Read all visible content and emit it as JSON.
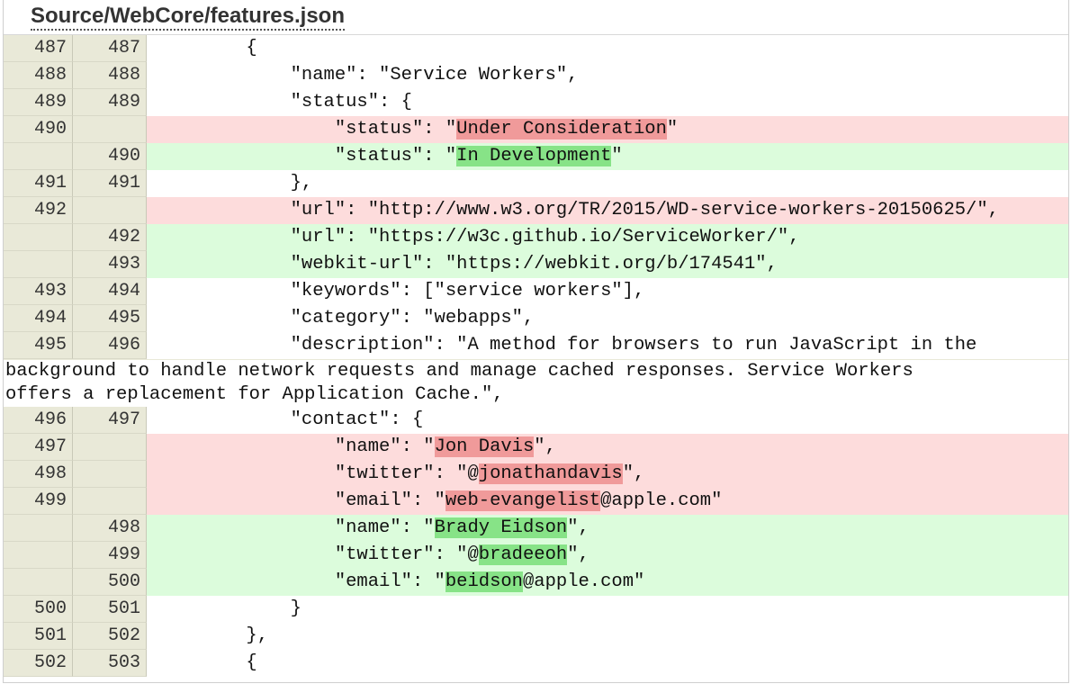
{
  "file_header": {
    "path": "Source/WebCore/features.json"
  },
  "lines": [
    {
      "old": "487",
      "new": "487",
      "type": "ctx",
      "segments": [
        {
          "t": "        {"
        }
      ]
    },
    {
      "old": "488",
      "new": "488",
      "type": "ctx",
      "segments": [
        {
          "t": "            \"name\": \"Service Workers\","
        }
      ]
    },
    {
      "old": "489",
      "new": "489",
      "type": "ctx",
      "segments": [
        {
          "t": "            \"status\": {"
        }
      ]
    },
    {
      "old": "490",
      "new": "",
      "type": "del",
      "segments": [
        {
          "t": "                \"status\": \""
        },
        {
          "t": "Under Consideration",
          "hl": true
        },
        {
          "t": "\""
        }
      ]
    },
    {
      "old": "",
      "new": "490",
      "type": "add",
      "segments": [
        {
          "t": "                \"status\": \""
        },
        {
          "t": "In Development",
          "hl": true
        },
        {
          "t": "\""
        }
      ]
    },
    {
      "old": "491",
      "new": "491",
      "type": "ctx",
      "segments": [
        {
          "t": "            },"
        }
      ]
    },
    {
      "old": "492",
      "new": "",
      "type": "del",
      "segments": [
        {
          "t": "            \"url\": \"http://www.w3.org/TR/2015/WD-service-workers-20150625/\","
        }
      ]
    },
    {
      "old": "",
      "new": "492",
      "type": "add",
      "segments": [
        {
          "t": "            \"url\": \"https://w3c.github.io/ServiceWorker/\","
        }
      ]
    },
    {
      "old": "",
      "new": "493",
      "type": "add",
      "segments": [
        {
          "t": "            \"webkit-url\": \"https://webkit.org/b/174541\","
        }
      ]
    },
    {
      "old": "493",
      "new": "494",
      "type": "ctx",
      "segments": [
        {
          "t": "            \"keywords\": [\"service workers\"],"
        }
      ]
    },
    {
      "old": "494",
      "new": "495",
      "type": "ctx",
      "segments": [
        {
          "t": "            \"category\": \"webapps\","
        }
      ]
    },
    {
      "old": "495",
      "new": "496",
      "type": "ctx",
      "segments": [
        {
          "t": "            \"description\": \"A method for browsers to run JavaScript in the"
        }
      ],
      "wrap": [
        "background to handle network requests and manage cached responses. Service Workers",
        "offers a replacement for Application Cache.\","
      ]
    },
    {
      "old": "496",
      "new": "497",
      "type": "ctx",
      "segments": [
        {
          "t": "            \"contact\": {"
        }
      ]
    },
    {
      "old": "497",
      "new": "",
      "type": "del",
      "segments": [
        {
          "t": "                \"name\": \""
        },
        {
          "t": "Jon Davis",
          "hl": true
        },
        {
          "t": "\","
        }
      ]
    },
    {
      "old": "498",
      "new": "",
      "type": "del",
      "segments": [
        {
          "t": "                \"twitter\": \"@"
        },
        {
          "t": "jonathandavis",
          "hl": true
        },
        {
          "t": "\","
        }
      ]
    },
    {
      "old": "499",
      "new": "",
      "type": "del",
      "segments": [
        {
          "t": "                \"email\": \""
        },
        {
          "t": "web-evangelist",
          "hl": true
        },
        {
          "t": "@apple.com\""
        }
      ]
    },
    {
      "old": "",
      "new": "498",
      "type": "add",
      "segments": [
        {
          "t": "                \"name\": \""
        },
        {
          "t": "Brady Eidson",
          "hl": true
        },
        {
          "t": "\","
        }
      ]
    },
    {
      "old": "",
      "new": "499",
      "type": "add",
      "segments": [
        {
          "t": "                \"twitter\": \"@"
        },
        {
          "t": "bradeeoh",
          "hl": true
        },
        {
          "t": "\","
        }
      ]
    },
    {
      "old": "",
      "new": "500",
      "type": "add",
      "segments": [
        {
          "t": "                \"email\": \""
        },
        {
          "t": "beidson",
          "hl": true
        },
        {
          "t": "@apple.com\""
        }
      ]
    },
    {
      "old": "500",
      "new": "501",
      "type": "ctx",
      "segments": [
        {
          "t": "            }"
        }
      ]
    },
    {
      "old": "501",
      "new": "502",
      "type": "ctx",
      "segments": [
        {
          "t": "        },"
        }
      ]
    },
    {
      "old": "502",
      "new": "503",
      "type": "ctx",
      "segments": [
        {
          "t": "        {"
        }
      ]
    }
  ]
}
